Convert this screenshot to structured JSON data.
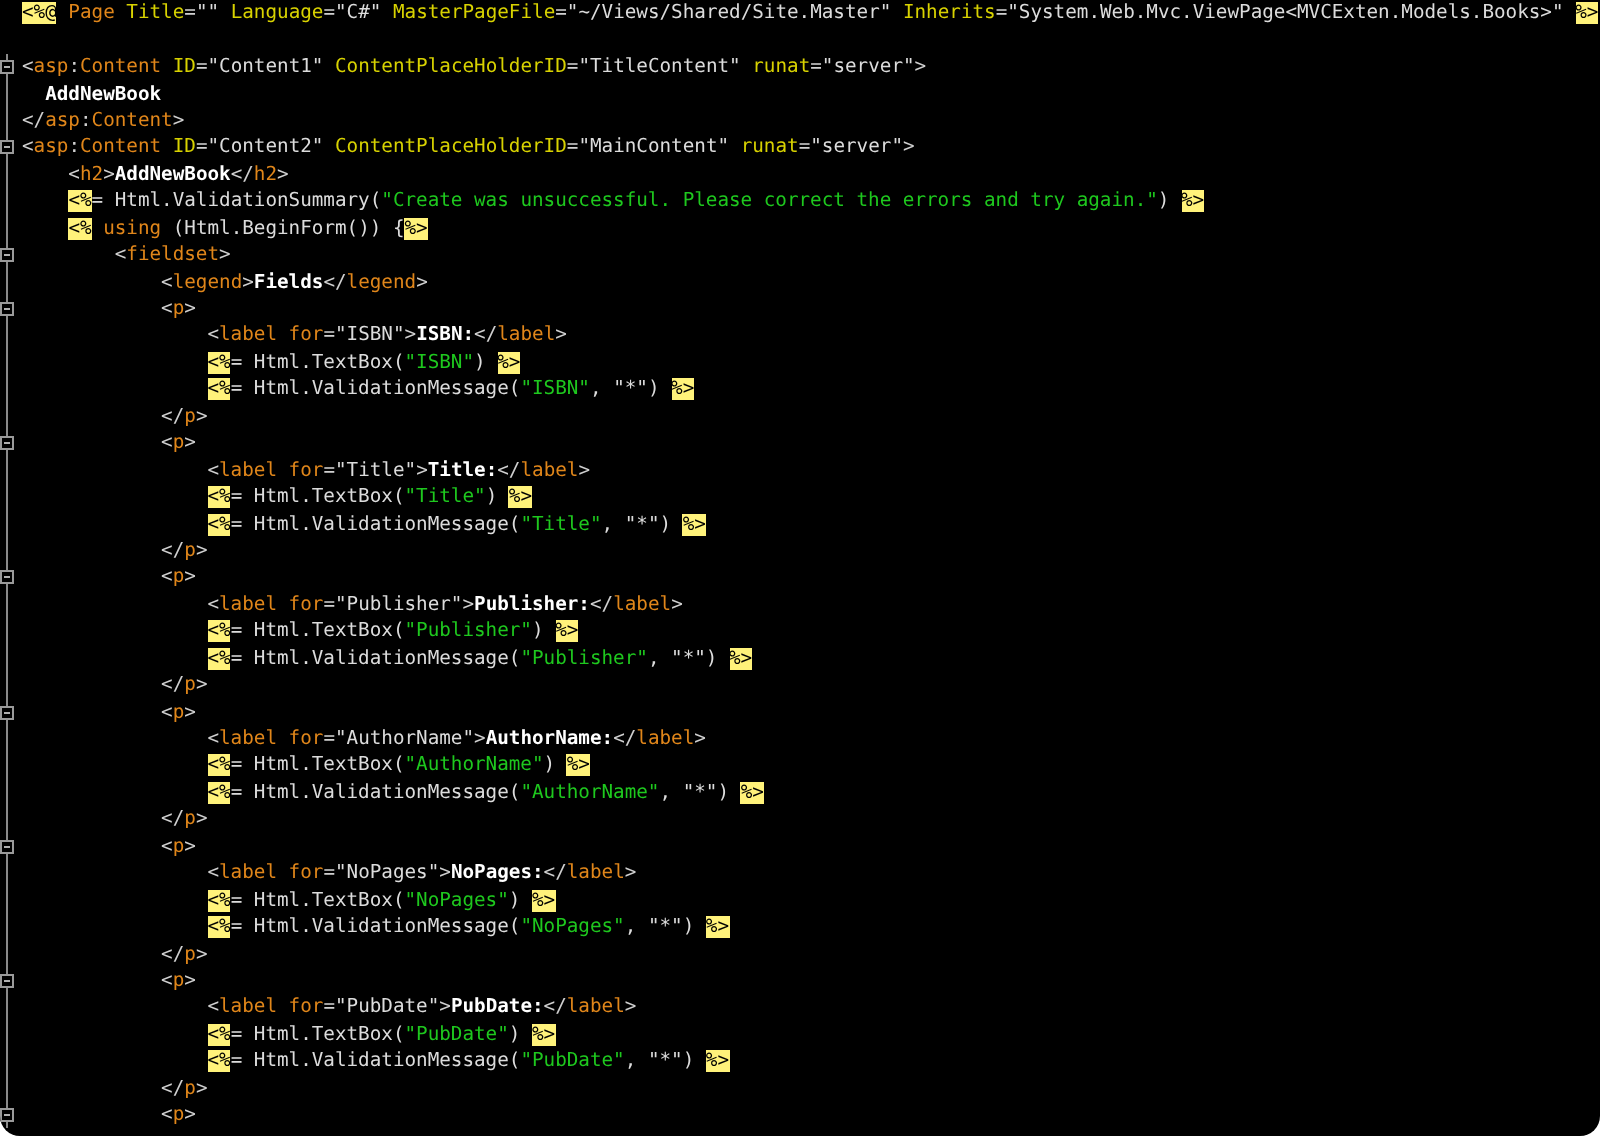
{
  "editor": {
    "lines": [
      {
        "collapsible": false,
        "tokens": [
          {
            "kind": "delimiter",
            "text": "<%@"
          },
          {
            "kind": "tag",
            "text": " Page"
          },
          {
            "kind": "attribute",
            "text": " Title"
          },
          {
            "kind": "punctuation",
            "text": "="
          },
          {
            "kind": "value",
            "text": "\"\""
          },
          {
            "kind": "attribute",
            "text": " Language"
          },
          {
            "kind": "punctuation",
            "text": "="
          },
          {
            "kind": "value",
            "text": "\"C#\""
          },
          {
            "kind": "attribute",
            "text": " MasterPageFile"
          },
          {
            "kind": "punctuation",
            "text": "="
          },
          {
            "kind": "value",
            "text": "\"~/Views/Shared/Site.Master\""
          },
          {
            "kind": "attribute",
            "text": " Inherits"
          },
          {
            "kind": "punctuation",
            "text": "="
          },
          {
            "kind": "value",
            "text": "\"System.Web.Mvc.ViewPage<MVCExten.Models.Books>\" "
          },
          {
            "kind": "delimiter",
            "text": "%>"
          }
        ]
      },
      {
        "collapsible": false
      },
      {
        "collapsible": true,
        "tokens": [
          {
            "kind": "punctuation",
            "text": "<"
          },
          {
            "kind": "tag",
            "text": "asp"
          },
          {
            "kind": "punctuation",
            "text": ":"
          },
          {
            "kind": "tag",
            "text": "Content"
          },
          {
            "kind": "attribute",
            "text": " ID"
          },
          {
            "kind": "punctuation",
            "text": "="
          },
          {
            "kind": "value",
            "text": "\"Content1\""
          },
          {
            "kind": "attribute",
            "text": " ContentPlaceHolderID"
          },
          {
            "kind": "punctuation",
            "text": "="
          },
          {
            "kind": "value",
            "text": "\"TitleContent\""
          },
          {
            "kind": "attribute",
            "text": " runat"
          },
          {
            "kind": "punctuation",
            "text": "="
          },
          {
            "kind": "value",
            "text": "\"server\""
          },
          {
            "kind": "punctuation",
            "text": ">"
          }
        ]
      },
      {
        "collapsible": false,
        "tokens": [
          {
            "kind": "content",
            "text": "  AddNewBook"
          }
        ]
      },
      {
        "collapsible": false,
        "tokens": [
          {
            "kind": "punctuation",
            "text": "</"
          },
          {
            "kind": "tag",
            "text": "asp"
          },
          {
            "kind": "punctuation",
            "text": ":"
          },
          {
            "kind": "tag",
            "text": "Content"
          },
          {
            "kind": "punctuation",
            "text": ">"
          }
        ]
      },
      {
        "collapsible": true,
        "tokens": [
          {
            "kind": "punctuation",
            "text": "<"
          },
          {
            "kind": "tag",
            "text": "asp"
          },
          {
            "kind": "punctuation",
            "text": ":"
          },
          {
            "kind": "tag",
            "text": "Content"
          },
          {
            "kind": "attribute",
            "text": " ID"
          },
          {
            "kind": "punctuation",
            "text": "="
          },
          {
            "kind": "value",
            "text": "\"Content2\""
          },
          {
            "kind": "attribute",
            "text": " ContentPlaceHolderID"
          },
          {
            "kind": "punctuation",
            "text": "="
          },
          {
            "kind": "value",
            "text": "\"MainContent\""
          },
          {
            "kind": "attribute",
            "text": " runat"
          },
          {
            "kind": "punctuation",
            "text": "="
          },
          {
            "kind": "value",
            "text": "\"server\""
          },
          {
            "kind": "punctuation",
            "text": ">"
          }
        ]
      },
      {
        "collapsible": false,
        "tokens": [
          {
            "kind": "punctuation",
            "text": "    <"
          },
          {
            "kind": "tag",
            "text": "h2"
          },
          {
            "kind": "punctuation",
            "text": ">"
          },
          {
            "kind": "content",
            "text": "AddNewBook"
          },
          {
            "kind": "punctuation",
            "text": "</"
          },
          {
            "kind": "tag",
            "text": "h2"
          },
          {
            "kind": "punctuation",
            "text": ">"
          }
        ]
      },
      {
        "collapsible": false,
        "tokens": [
          {
            "kind": "delimiter",
            "text": "    <%"
          },
          {
            "kind": "code",
            "text": "= Html.ValidationSummary("
          },
          {
            "kind": "string",
            "text": "\"Create was unsuccessful. Please correct the errors and try again.\""
          },
          {
            "kind": "code",
            "text": ") "
          },
          {
            "kind": "delimiter",
            "text": "%>"
          }
        ]
      },
      {
        "collapsible": false,
        "tokens": [
          {
            "kind": "delimiter",
            "text": "    <%"
          },
          {
            "kind": "keyword",
            "text": " using"
          },
          {
            "kind": "code",
            "text": " (Html.BeginForm()) {"
          },
          {
            "kind": "delimiter",
            "text": "%>"
          }
        ]
      },
      {
        "collapsible": true,
        "tokens": [
          {
            "kind": "punctuation",
            "text": "        <"
          },
          {
            "kind": "tag",
            "text": "fieldset"
          },
          {
            "kind": "punctuation",
            "text": ">"
          }
        ]
      },
      {
        "collapsible": false,
        "tokens": [
          {
            "kind": "punctuation",
            "text": "            <"
          },
          {
            "kind": "tag",
            "text": "legend"
          },
          {
            "kind": "punctuation",
            "text": ">"
          },
          {
            "kind": "content",
            "text": "Fields"
          },
          {
            "kind": "punctuation",
            "text": "</"
          },
          {
            "kind": "tag",
            "text": "legend"
          },
          {
            "kind": "punctuation",
            "text": ">"
          }
        ]
      },
      {
        "collapsible": true,
        "tokens": [
          {
            "kind": "punctuation",
            "text": "            <"
          },
          {
            "kind": "tag",
            "text": "p"
          },
          {
            "kind": "punctuation",
            "text": ">"
          }
        ]
      },
      {
        "collapsible": false,
        "tokens": [
          {
            "kind": "punctuation",
            "text": "                <"
          },
          {
            "kind": "tag",
            "text": "label"
          },
          {
            "kind": "tag",
            "text": " for"
          },
          {
            "kind": "punctuation",
            "text": "="
          },
          {
            "kind": "value",
            "text": "\"ISBN\""
          },
          {
            "kind": "punctuation",
            "text": ">"
          },
          {
            "kind": "content",
            "text": "ISBN:"
          },
          {
            "kind": "punctuation",
            "text": "</"
          },
          {
            "kind": "tag",
            "text": "label"
          },
          {
            "kind": "punctuation",
            "text": ">"
          }
        ]
      },
      {
        "collapsible": false,
        "tokens": [
          {
            "kind": "delimiter",
            "text": "                <%"
          },
          {
            "kind": "code",
            "text": "= Html.TextBox("
          },
          {
            "kind": "string",
            "text": "\"ISBN\""
          },
          {
            "kind": "code",
            "text": ") "
          },
          {
            "kind": "delimiter",
            "text": "%>"
          }
        ]
      },
      {
        "collapsible": false,
        "tokens": [
          {
            "kind": "delimiter",
            "text": "                <%"
          },
          {
            "kind": "code",
            "text": "= Html.ValidationMessage("
          },
          {
            "kind": "string",
            "text": "\"ISBN\""
          },
          {
            "kind": "code",
            "text": ", "
          },
          {
            "kind": "value",
            "text": "\"*\""
          },
          {
            "kind": "code",
            "text": ") "
          },
          {
            "kind": "delimiter",
            "text": "%>"
          }
        ]
      },
      {
        "collapsible": false,
        "tokens": [
          {
            "kind": "punctuation",
            "text": "            </"
          },
          {
            "kind": "tag",
            "text": "p"
          },
          {
            "kind": "punctuation",
            "text": ">"
          }
        ]
      },
      {
        "collapsible": true,
        "tokens": [
          {
            "kind": "punctuation",
            "text": "            <"
          },
          {
            "kind": "tag",
            "text": "p"
          },
          {
            "kind": "punctuation",
            "text": ">"
          }
        ]
      },
      {
        "collapsible": false,
        "tokens": [
          {
            "kind": "punctuation",
            "text": "                <"
          },
          {
            "kind": "tag",
            "text": "label"
          },
          {
            "kind": "tag",
            "text": " for"
          },
          {
            "kind": "punctuation",
            "text": "="
          },
          {
            "kind": "value",
            "text": "\"Title\""
          },
          {
            "kind": "punctuation",
            "text": ">"
          },
          {
            "kind": "content",
            "text": "Title:"
          },
          {
            "kind": "punctuation",
            "text": "</"
          },
          {
            "kind": "tag",
            "text": "label"
          },
          {
            "kind": "punctuation",
            "text": ">"
          }
        ]
      },
      {
        "collapsible": false,
        "tokens": [
          {
            "kind": "delimiter",
            "text": "                <%"
          },
          {
            "kind": "code",
            "text": "= Html.TextBox("
          },
          {
            "kind": "string",
            "text": "\"Title\""
          },
          {
            "kind": "code",
            "text": ") "
          },
          {
            "kind": "delimiter",
            "text": "%>"
          }
        ]
      },
      {
        "collapsible": false,
        "tokens": [
          {
            "kind": "delimiter",
            "text": "                <%"
          },
          {
            "kind": "code",
            "text": "= Html.ValidationMessage("
          },
          {
            "kind": "string",
            "text": "\"Title\""
          },
          {
            "kind": "code",
            "text": ", "
          },
          {
            "kind": "value",
            "text": "\"*\""
          },
          {
            "kind": "code",
            "text": ") "
          },
          {
            "kind": "delimiter",
            "text": "%>"
          }
        ]
      },
      {
        "collapsible": false,
        "tokens": [
          {
            "kind": "punctuation",
            "text": "            </"
          },
          {
            "kind": "tag",
            "text": "p"
          },
          {
            "kind": "punctuation",
            "text": ">"
          }
        ]
      },
      {
        "collapsible": true,
        "tokens": [
          {
            "kind": "punctuation",
            "text": "            <"
          },
          {
            "kind": "tag",
            "text": "p"
          },
          {
            "kind": "punctuation",
            "text": ">"
          }
        ]
      },
      {
        "collapsible": false,
        "tokens": [
          {
            "kind": "punctuation",
            "text": "                <"
          },
          {
            "kind": "tag",
            "text": "label"
          },
          {
            "kind": "tag",
            "text": " for"
          },
          {
            "kind": "punctuation",
            "text": "="
          },
          {
            "kind": "value",
            "text": "\"Publisher\""
          },
          {
            "kind": "punctuation",
            "text": ">"
          },
          {
            "kind": "content",
            "text": "Publisher:"
          },
          {
            "kind": "punctuation",
            "text": "</"
          },
          {
            "kind": "tag",
            "text": "label"
          },
          {
            "kind": "punctuation",
            "text": ">"
          }
        ]
      },
      {
        "collapsible": false,
        "tokens": [
          {
            "kind": "delimiter",
            "text": "                <%"
          },
          {
            "kind": "code",
            "text": "= Html.TextBox("
          },
          {
            "kind": "string",
            "text": "\"Publisher\""
          },
          {
            "kind": "code",
            "text": ") "
          },
          {
            "kind": "delimiter",
            "text": "%>"
          }
        ]
      },
      {
        "collapsible": false,
        "tokens": [
          {
            "kind": "delimiter",
            "text": "                <%"
          },
          {
            "kind": "code",
            "text": "= Html.ValidationMessage("
          },
          {
            "kind": "string",
            "text": "\"Publisher\""
          },
          {
            "kind": "code",
            "text": ", "
          },
          {
            "kind": "value",
            "text": "\"*\""
          },
          {
            "kind": "code",
            "text": ") "
          },
          {
            "kind": "delimiter",
            "text": "%>"
          }
        ]
      },
      {
        "collapsible": false,
        "tokens": [
          {
            "kind": "punctuation",
            "text": "            </"
          },
          {
            "kind": "tag",
            "text": "p"
          },
          {
            "kind": "punctuation",
            "text": ">"
          }
        ]
      },
      {
        "collapsible": true,
        "tokens": [
          {
            "kind": "punctuation",
            "text": "            <"
          },
          {
            "kind": "tag",
            "text": "p"
          },
          {
            "kind": "punctuation",
            "text": ">"
          }
        ]
      },
      {
        "collapsible": false,
        "tokens": [
          {
            "kind": "punctuation",
            "text": "                <"
          },
          {
            "kind": "tag",
            "text": "label"
          },
          {
            "kind": "tag",
            "text": " for"
          },
          {
            "kind": "punctuation",
            "text": "="
          },
          {
            "kind": "value",
            "text": "\"AuthorName\""
          },
          {
            "kind": "punctuation",
            "text": ">"
          },
          {
            "kind": "content",
            "text": "AuthorName:"
          },
          {
            "kind": "punctuation",
            "text": "</"
          },
          {
            "kind": "tag",
            "text": "label"
          },
          {
            "kind": "punctuation",
            "text": ">"
          }
        ]
      },
      {
        "collapsible": false,
        "tokens": [
          {
            "kind": "delimiter",
            "text": "                <%"
          },
          {
            "kind": "code",
            "text": "= Html.TextBox("
          },
          {
            "kind": "string",
            "text": "\"AuthorName\""
          },
          {
            "kind": "code",
            "text": ") "
          },
          {
            "kind": "delimiter",
            "text": "%>"
          }
        ]
      },
      {
        "collapsible": false,
        "tokens": [
          {
            "kind": "delimiter",
            "text": "                <%"
          },
          {
            "kind": "code",
            "text": "= Html.ValidationMessage("
          },
          {
            "kind": "string",
            "text": "\"AuthorName\""
          },
          {
            "kind": "code",
            "text": ", "
          },
          {
            "kind": "value",
            "text": "\"*\""
          },
          {
            "kind": "code",
            "text": ") "
          },
          {
            "kind": "delimiter",
            "text": "%>"
          }
        ]
      },
      {
        "collapsible": false,
        "tokens": [
          {
            "kind": "punctuation",
            "text": "            </"
          },
          {
            "kind": "tag",
            "text": "p"
          },
          {
            "kind": "punctuation",
            "text": ">"
          }
        ]
      },
      {
        "collapsible": true,
        "tokens": [
          {
            "kind": "punctuation",
            "text": "            <"
          },
          {
            "kind": "tag",
            "text": "p"
          },
          {
            "kind": "punctuation",
            "text": ">"
          }
        ]
      },
      {
        "collapsible": false,
        "tokens": [
          {
            "kind": "punctuation",
            "text": "                <"
          },
          {
            "kind": "tag",
            "text": "label"
          },
          {
            "kind": "tag",
            "text": " for"
          },
          {
            "kind": "punctuation",
            "text": "="
          },
          {
            "kind": "value",
            "text": "\"NoPages\""
          },
          {
            "kind": "punctuation",
            "text": ">"
          },
          {
            "kind": "content",
            "text": "NoPages:"
          },
          {
            "kind": "punctuation",
            "text": "</"
          },
          {
            "kind": "tag",
            "text": "label"
          },
          {
            "kind": "punctuation",
            "text": ">"
          }
        ]
      },
      {
        "collapsible": false,
        "tokens": [
          {
            "kind": "delimiter",
            "text": "                <%"
          },
          {
            "kind": "code",
            "text": "= Html.TextBox("
          },
          {
            "kind": "string",
            "text": "\"NoPages\""
          },
          {
            "kind": "code",
            "text": ") "
          },
          {
            "kind": "delimiter",
            "text": "%>"
          }
        ]
      },
      {
        "collapsible": false,
        "tokens": [
          {
            "kind": "delimiter",
            "text": "                <%"
          },
          {
            "kind": "code",
            "text": "= Html.ValidationMessage("
          },
          {
            "kind": "string",
            "text": "\"NoPages\""
          },
          {
            "kind": "code",
            "text": ", "
          },
          {
            "kind": "value",
            "text": "\"*\""
          },
          {
            "kind": "code",
            "text": ") "
          },
          {
            "kind": "delimiter",
            "text": "%>"
          }
        ]
      },
      {
        "collapsible": false,
        "tokens": [
          {
            "kind": "punctuation",
            "text": "            </"
          },
          {
            "kind": "tag",
            "text": "p"
          },
          {
            "kind": "punctuation",
            "text": ">"
          }
        ]
      },
      {
        "collapsible": true,
        "tokens": [
          {
            "kind": "punctuation",
            "text": "            <"
          },
          {
            "kind": "tag",
            "text": "p"
          },
          {
            "kind": "punctuation",
            "text": ">"
          }
        ]
      },
      {
        "collapsible": false,
        "tokens": [
          {
            "kind": "punctuation",
            "text": "                <"
          },
          {
            "kind": "tag",
            "text": "label"
          },
          {
            "kind": "tag",
            "text": " for"
          },
          {
            "kind": "punctuation",
            "text": "="
          },
          {
            "kind": "value",
            "text": "\"PubDate\""
          },
          {
            "kind": "punctuation",
            "text": ">"
          },
          {
            "kind": "content",
            "text": "PubDate:"
          },
          {
            "kind": "punctuation",
            "text": "</"
          },
          {
            "kind": "tag",
            "text": "label"
          },
          {
            "kind": "punctuation",
            "text": ">"
          }
        ]
      },
      {
        "collapsible": false,
        "tokens": [
          {
            "kind": "delimiter",
            "text": "                <%"
          },
          {
            "kind": "code",
            "text": "= Html.TextBox("
          },
          {
            "kind": "string",
            "text": "\"PubDate\""
          },
          {
            "kind": "code",
            "text": ") "
          },
          {
            "kind": "delimiter",
            "text": "%>"
          }
        ]
      },
      {
        "collapsible": false,
        "tokens": [
          {
            "kind": "delimiter",
            "text": "                <%"
          },
          {
            "kind": "code",
            "text": "= Html.ValidationMessage("
          },
          {
            "kind": "string",
            "text": "\"PubDate\""
          },
          {
            "kind": "code",
            "text": ", "
          },
          {
            "kind": "value",
            "text": "\"*\""
          },
          {
            "kind": "code",
            "text": ") "
          },
          {
            "kind": "delimiter",
            "text": "%>"
          }
        ]
      },
      {
        "collapsible": false,
        "tokens": [
          {
            "kind": "punctuation",
            "text": "            </"
          },
          {
            "kind": "tag",
            "text": "p"
          },
          {
            "kind": "punctuation",
            "text": ">"
          }
        ]
      },
      {
        "collapsible": true,
        "tokens": [
          {
            "kind": "punctuation",
            "text": "            <"
          },
          {
            "kind": "tag",
            "text": "p"
          },
          {
            "kind": "punctuation",
            "text": ">"
          }
        ]
      }
    ]
  }
}
